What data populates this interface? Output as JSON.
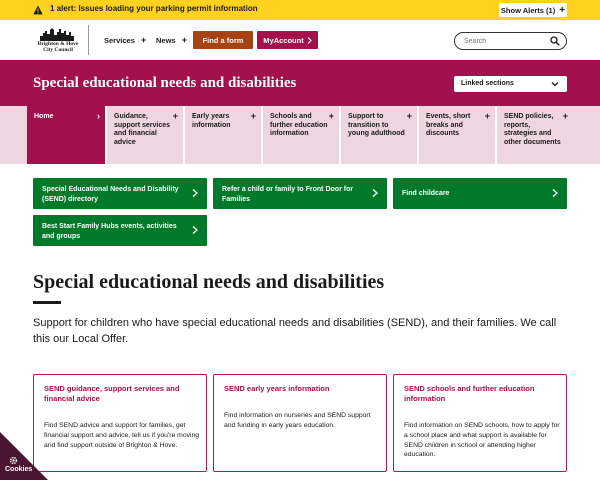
{
  "alert": {
    "text": "1 alert: Issues loading your parking permit information",
    "button_label": "Show Alerts (1)",
    "button_icon": "+"
  },
  "header": {
    "logo_text_line1": "Brighton & Hove",
    "logo_text_line2": "City Council",
    "nav_services": "Services",
    "nav_news": "News",
    "find_form_label": "Find a form",
    "myaccount_label": "MyAccount",
    "search_placeholder": "Search"
  },
  "banner": {
    "title": "Special educational needs and disabilities",
    "linked_sections_label": "Linked sections"
  },
  "section_nav": {
    "items": [
      {
        "label": "Home",
        "marker": "›"
      },
      {
        "label": "Guidance, support services and financial advice",
        "marker": "+"
      },
      {
        "label": "Early years information",
        "marker": "+"
      },
      {
        "label": "Schools and further education information",
        "marker": "+"
      },
      {
        "label": "Support to transition to young adulthood",
        "marker": "+"
      },
      {
        "label": "Events, short breaks and discounts",
        "marker": "+"
      },
      {
        "label": "SEND policies, reports, strategies and other documents",
        "marker": "+"
      }
    ]
  },
  "quick_links": [
    {
      "label": "Special Educational Needs and Disability (SEND) directory"
    },
    {
      "label": "Refer a child or family to Front Door for Families"
    },
    {
      "label": "Find childcare"
    },
    {
      "label": "Best Start Family Hubs events, activities and groups"
    }
  ],
  "main": {
    "heading": "Special educational needs and disabilities",
    "intro": "Support for children who have special educational needs and disabilities (SEND), and their families. We call this our Local Offer."
  },
  "cards": [
    {
      "title": "SEND guidance, support services and financial advice",
      "body": "Find SEND advice and support for families, get financial support and advice, tell us if you're moving and find support outside of Brighton & Hove."
    },
    {
      "title": "SEND early years information",
      "body": "Find information on nurseries and SEND support and funding in early years education."
    },
    {
      "title": "SEND schools and further education information",
      "body": "Find information on SEND schools, how to apply for a school place and what support is available for SEND children in school or attending higher education."
    }
  ],
  "cookies": {
    "label": "Cookies"
  },
  "colors": {
    "alert_bg": "#ffd21f",
    "brand_magenta": "#a3104e",
    "find_form_orange": "#a54412",
    "nav_bg": "#eed6e0",
    "quick_link_green": "#00792a",
    "cookies_bg": "#4a1533"
  }
}
